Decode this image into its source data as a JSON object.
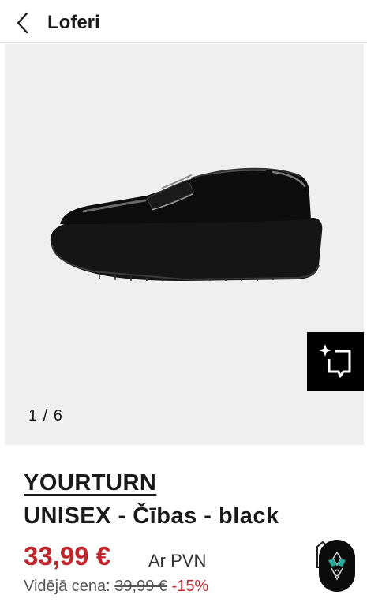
{
  "header": {
    "title": "Loferi",
    "back_icon": "chevron-left-icon"
  },
  "gallery": {
    "counter": "1 / 6",
    "image_subject": "black patent leather chunky loafer",
    "tryon_icon": "sparkle-chat-icon"
  },
  "product": {
    "brand": "YOURTURN",
    "name": "UNISEX - Čības - black",
    "price": "33,99 €",
    "vat_label": "Ar PVN",
    "avg_label": "Vidējā cena:",
    "avg_price": "39,99 €",
    "discount": "-15%"
  },
  "assistant": {
    "icon": "assistant-logo-icon",
    "tag_icon": "price-tag-icon"
  },
  "colors": {
    "price_red": "#c0272d",
    "gallery_bg": "#efefef",
    "button_black": "#000000"
  }
}
